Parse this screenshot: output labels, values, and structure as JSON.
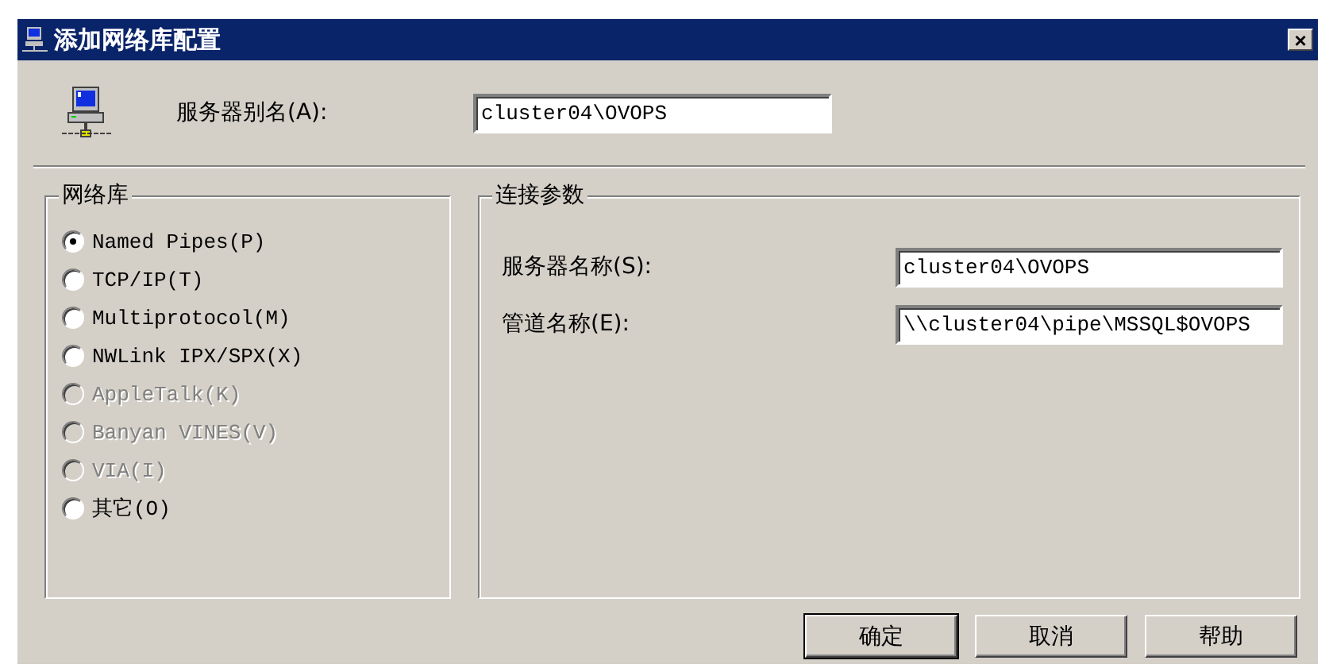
{
  "window": {
    "title": "添加网络库配置",
    "close": "×"
  },
  "alias": {
    "label": "服务器别名(A):",
    "value": "cluster04\\OVOPS"
  },
  "network_library": {
    "title": "网络库",
    "options": [
      {
        "label": "Named Pipes(P)",
        "selected": true,
        "disabled": false
      },
      {
        "label": "TCP/IP(T)",
        "selected": false,
        "disabled": false
      },
      {
        "label": "Multiprotocol(M)",
        "selected": false,
        "disabled": false
      },
      {
        "label": "NWLink IPX/SPX(X)",
        "selected": false,
        "disabled": false
      },
      {
        "label": "AppleTalk(K)",
        "selected": false,
        "disabled": true
      },
      {
        "label": "Banyan VINES(V)",
        "selected": false,
        "disabled": true
      },
      {
        "label": "VIA(I)",
        "selected": false,
        "disabled": true
      },
      {
        "label": "其它(O)",
        "selected": false,
        "disabled": false
      }
    ]
  },
  "connection_parameters": {
    "title": "连接参数",
    "fields": [
      {
        "label": "服务器名称(S):",
        "value": "cluster04\\OVOPS"
      },
      {
        "label": "管道名称(E):",
        "value": "\\\\cluster04\\pipe\\MSSQL$OVOPS"
      }
    ]
  },
  "buttons": [
    {
      "label": "确定",
      "default": true
    },
    {
      "label": "取消",
      "default": false
    },
    {
      "label": "帮助",
      "default": false
    }
  ]
}
